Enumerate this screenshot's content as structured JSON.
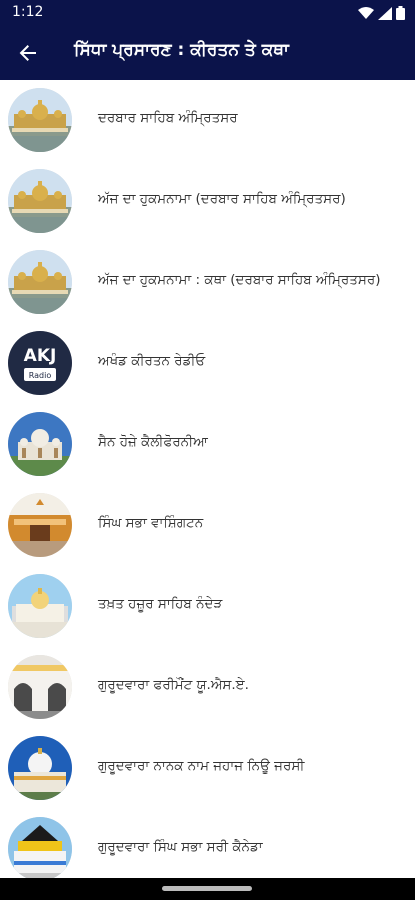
{
  "status_bar": {
    "time": "1:12",
    "icons": [
      "wifi-icon",
      "signal-icon",
      "battery-icon"
    ]
  },
  "app_bar": {
    "title": "ਸਿੱਧਾ ਪ੍ਰਸਾਰਣ : ਕੀਰਤਨ ਤੇ ਕਥਾ",
    "back_icon": "arrow-left-icon",
    "background": "#0b134a"
  },
  "items": [
    {
      "label": "ਦਰਬਾਰ ਸਾਹਿਬ ਅੰਮ੍ਰਿਤਸਰ",
      "thumb": "golden-temple"
    },
    {
      "label": "ਅੱਜ ਦਾ ਹੁਕਮਨਾਮਾ (ਦਰਬਾਰ ਸਾਹਿਬ ਅੰਮ੍ਰਿਤਸਰ)",
      "thumb": "golden-temple"
    },
    {
      "label": "ਅੱਜ ਦਾ ਹੁਕਮਨਾਮਾ : ਕਥਾ  (ਦਰਬਾਰ ਸਾਹਿਬ ਅੰਮ੍ਰਿਤਸਰ)",
      "thumb": "golden-temple"
    },
    {
      "label": "ਅਖੰਡ ਕੀਰਤਨ ਰੇਡੀਓ",
      "thumb": "akj-radio",
      "thumb_text": "AKJ",
      "thumb_sub": "Radio"
    },
    {
      "label": "ਸੈਨ ਹੋਜ਼ੇ ਕੈਲੀਫੋਰਨੀਆ",
      "thumb": "white-dome"
    },
    {
      "label": "ਸਿੰਘ ਸਭਾ ਵਾਸ਼ਿੰਗਟਨ",
      "thumb": "orange-building"
    },
    {
      "label": "ਤਖ਼ਤ ਹਜ਼ੂਰ ਸਾਹਿਬ ਨੰਦੇੜ",
      "thumb": "hazur-sahib"
    },
    {
      "label": "ਗੁਰੂਦਵਾਰਾ ਫਰੀਮੌਂਟ ਯੂ.ਐਸ.ਏ.",
      "thumb": "arches"
    },
    {
      "label": "ਗੁਰੂਦਵਾਰਾ ਨਾਨਕ ਨਾਮ ਜਹਾਜ ਨਿਊ ਜਰਸੀ",
      "thumb": "dome-blue"
    },
    {
      "label": "ਗੁਰੂਦਵਾਰਾ ਸਿੰਘ ਸਭਾ ਸਰੀ ਕੈਨੇਡਾ",
      "thumb": "surrey"
    }
  ]
}
